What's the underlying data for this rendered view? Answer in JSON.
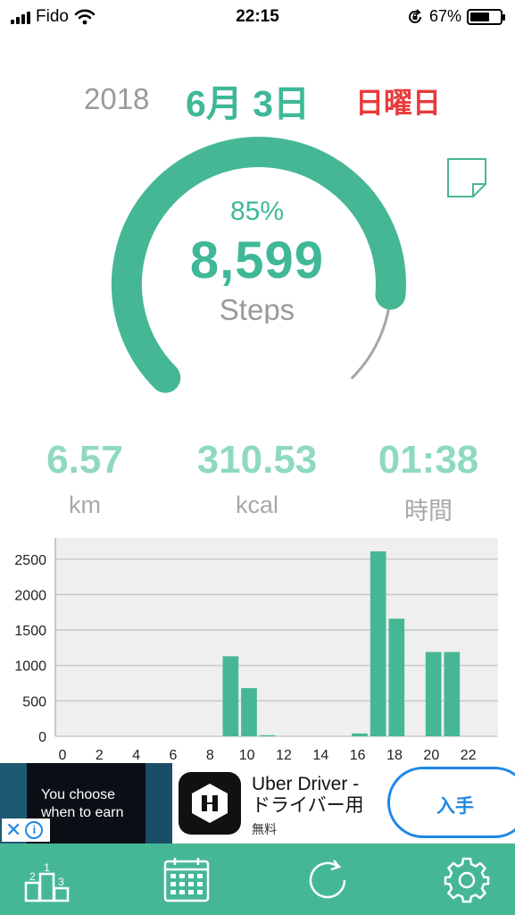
{
  "status_bar": {
    "carrier": "Fido",
    "time": "22:15",
    "battery_pct": "67%",
    "battery_level": 0.67
  },
  "header": {
    "year": "2018",
    "date": "6月 3日",
    "weekday": "日曜日"
  },
  "gauge": {
    "percent_label": "85%",
    "progress": 0.85,
    "steps": "8,599",
    "steps_label": "Steps"
  },
  "stats": {
    "distance": {
      "value": "6.57",
      "unit": "km"
    },
    "calories": {
      "value": "310.53",
      "unit": "kcal"
    },
    "time": {
      "value": "01:38",
      "unit": "時間"
    }
  },
  "chart_data": {
    "type": "bar",
    "x": [
      0,
      1,
      2,
      3,
      4,
      5,
      6,
      7,
      8,
      9,
      10,
      11,
      12,
      13,
      14,
      15,
      16,
      17,
      18,
      19,
      20,
      21,
      22,
      23
    ],
    "values": [
      0,
      0,
      0,
      0,
      0,
      0,
      0,
      0,
      0,
      1130,
      680,
      15,
      0,
      0,
      0,
      0,
      40,
      2610,
      1660,
      0,
      1190,
      1190,
      0,
      0
    ],
    "x_tick_labels": [
      "0",
      "2",
      "4",
      "6",
      "8",
      "10",
      "12",
      "14",
      "16",
      "18",
      "20",
      "22"
    ],
    "y_tick_labels": [
      "0",
      "500",
      "1000",
      "1500",
      "2000",
      "2500"
    ],
    "ylim": [
      0,
      2800
    ],
    "grid": true,
    "bar_color": "#46b795",
    "background": "#efefef"
  },
  "ad": {
    "tagline": "You choose when to earn",
    "app_title_line1": "Uber Driver -",
    "app_title_line2": "ドライバー用",
    "app_subtitle": "無料",
    "cta": "入手"
  },
  "colors": {
    "accent": "#3fb897",
    "weekday": "#e83a3a",
    "tabbar": "#46b795"
  },
  "tabbar": {
    "items": [
      {
        "icon": "ranking-icon"
      },
      {
        "icon": "calendar-icon"
      },
      {
        "icon": "refresh-icon"
      },
      {
        "icon": "gear-icon"
      }
    ]
  }
}
